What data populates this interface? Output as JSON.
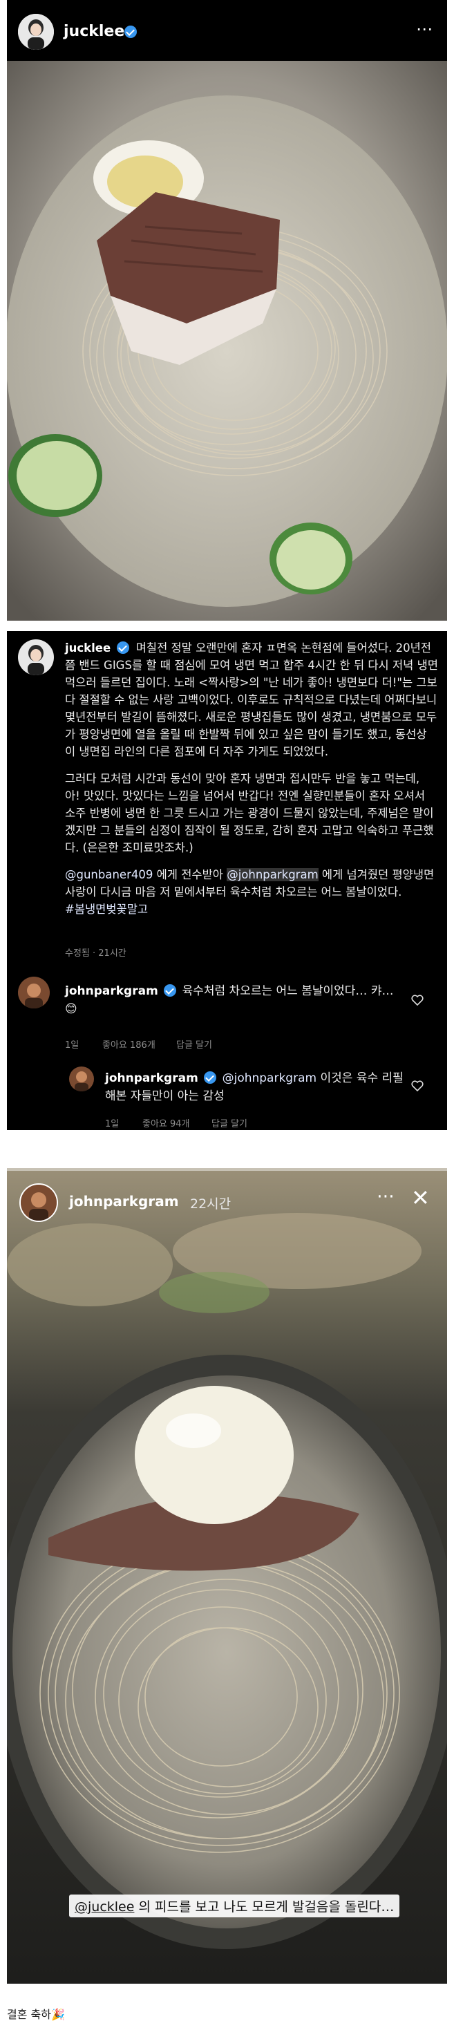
{
  "post": {
    "username": "jucklee",
    "more_icon": "⋯"
  },
  "caption": {
    "username": "jucklee",
    "paragraph1": "며칠전 정말 오랜만에 혼자 ㅍ면옥 논현점에 들어섰다. 20년전쯤 밴드 GIGS를 할 때 점심에 모여 냉면 먹고 합주 4시간 한 뒤 다시 저녁 냉면 먹으러 들르던 집이다. 노래 <짝사랑>의 \"난 네가 좋아! 냉면보다 더!\"는 그보다 절절할 수 없는 사랑 고백이었다. 이후로도 규칙적으로 다녔는데 어쩌다보니 몇년전부터 발길이 뜸해졌다. 새로운 평냉집들도 많이 생겼고, 냉면붐으로 모두가 평양냉면에 열을 올릴 때 한발짝 뒤에 있고 싶은 맘이 들기도 했고, 동선상 이 냉면집 라인의 다른 점포에 더 자주 가게도 되었었다.",
    "paragraph2": "그러다 모처럼 시간과 동선이 맞아 혼자 냉면과 접시만두 반을 놓고 먹는데, 아! 맛있다. 맛있다는 느낌을 넘어서 반갑다! 전엔 실향민분들이 혼자 오셔서 소주 반병에 냉면 한 그릇 드시고 가는 광경이 드물지 않았는데, 주제넘은 말이겠지만 그 분들의 심정이 짐작이 될 정도로, 감히 혼자 고맙고 익숙하고 푸근했다. (은은한 조미료맛조차.)",
    "mention1": "@gunbaner409",
    "paragraph3a": " 에게 전수받아 ",
    "mention2": "@johnparkgram",
    "paragraph3b": " 에게 넘겨줬던 평양냉면사랑이 다시금 마음 저 밑에서부터 육수처럼 차오르는 어느 봄날이었다.",
    "hashtag": "#봄냉면벚꽃말고",
    "meta": "수정됨 · 21시간"
  },
  "comments": [
    {
      "username": "johnparkgram",
      "text": "육수처럼 차오르는 어느 봄날이었다… 캬… 😊",
      "time": "1일",
      "likes": "좋아요 186개",
      "reply": "답글 달기"
    },
    {
      "username": "johnparkgram",
      "mention": "@johnparkgram",
      "text": " 이것은 육수 리필해본 자들만이 아는 감성",
      "time": "1일",
      "likes": "좋아요 94개",
      "reply": "답글 달기"
    }
  ],
  "story": {
    "username": "johnparkgram",
    "time": "22시간",
    "close_icon": "✕",
    "caption_mention": "@jucklee",
    "caption_text": " 의 피드를 보고  나도 모르게 발걸음을 돌린다…"
  },
  "footer": {
    "text": "결혼 축하🎉"
  }
}
